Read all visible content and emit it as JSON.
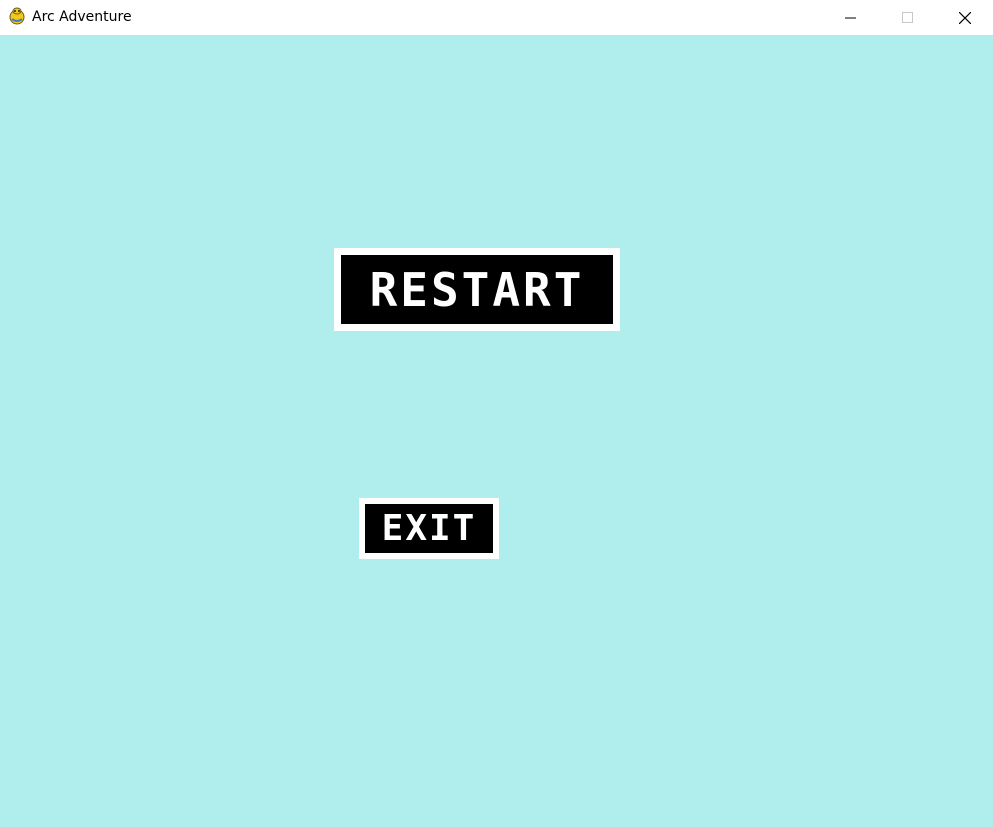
{
  "window": {
    "title": "Arc Adventure",
    "icon": "pygame-snake-icon",
    "controls": {
      "minimize_icon": "minimize-icon",
      "maximize_icon": "maximize-icon",
      "close_icon": "close-icon"
    }
  },
  "game": {
    "background_color": "#b0eded",
    "buttons": {
      "restart_label": "RESTART",
      "exit_label": "EXIT"
    },
    "button_style": {
      "fill": "#000000",
      "border": "#ffffff",
      "text": "#ffffff"
    }
  }
}
